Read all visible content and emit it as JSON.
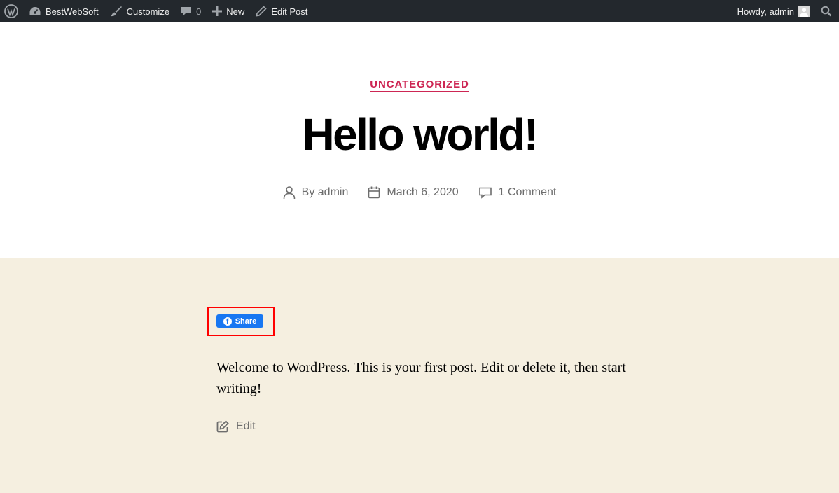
{
  "adminbar": {
    "site_name": "BestWebSoft",
    "customize": "Customize",
    "comments_count": "0",
    "new": "New",
    "edit_post": "Edit Post",
    "howdy": "Howdy, admin"
  },
  "post": {
    "category": "UNCATEGORIZED",
    "title": "Hello world!",
    "author": "By admin",
    "date": "March 6, 2020",
    "comments": "1 Comment",
    "body": "Welcome to WordPress. This is your first post. Edit or delete it, then start writing!",
    "edit": "Edit"
  },
  "share": {
    "label": "Share",
    "icon_letter": "f"
  },
  "colors": {
    "adminbar_bg": "#23282d",
    "accent": "#cd2653",
    "content_bg": "#f5efe0",
    "facebook_blue": "#1877f2",
    "highlight": "#ff0000"
  },
  "icons": [
    "wordpress-logo-icon",
    "dashboard-icon",
    "brush-icon",
    "comment-bubble-icon",
    "plus-icon",
    "pencil-icon",
    "avatar-icon",
    "search-icon",
    "user-icon",
    "calendar-icon",
    "comment-icon",
    "facebook-icon",
    "edit-icon"
  ]
}
